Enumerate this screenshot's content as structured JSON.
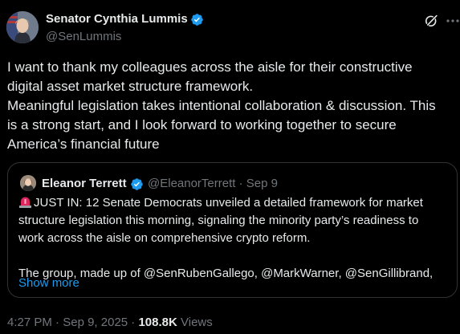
{
  "author": {
    "name": "Senator Cynthia Lummis",
    "handle": "@SenLummis"
  },
  "icons": {
    "verified": "verified-badge-icon",
    "grok": "grok-icon",
    "more": "more-options-icon",
    "siren": "siren-emoji-icon"
  },
  "colors": {
    "background": "#000000",
    "text": "#e7e9ea",
    "muted": "#71767b",
    "accent": "#1d9bf0",
    "border": "#2f3336"
  },
  "tweet": {
    "lines": [
      "I want to thank my colleagues across the aisle for their constructive",
      "digital asset market structure framework.",
      "Meaningful legislation takes intentional collaboration & discussion. This",
      "is a strong start, and I look forward to working together to secure",
      "America’s financial future"
    ]
  },
  "quote": {
    "name": "Eleanor Terrett",
    "handle": "@EleanorTerrett",
    "separator": "·",
    "date": "Sep 9",
    "lines": [
      "JUST IN: 12 Senate Democrats unveiled a detailed framework for market",
      "structure legislation this morning, signaling the minority party’s readiness to",
      "work across the aisle on comprehensive crypto reform.",
      "",
      "The group, made up of @SenRubenGallego, @MarkWarner, @SenGillibrand,"
    ],
    "show_more": "Show more"
  },
  "footer": {
    "time": "4:27 PM",
    "separator": "·",
    "date": "Sep 9, 2025",
    "views_count": "108.8K",
    "views_label": "Views"
  }
}
